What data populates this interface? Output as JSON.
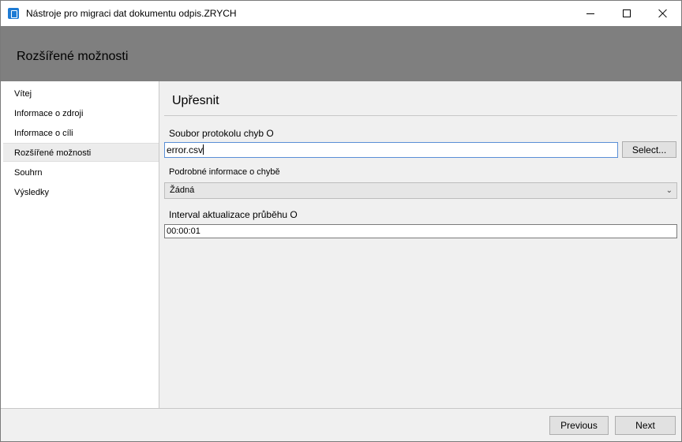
{
  "window": {
    "title": "Nástroje pro migraci dat dokumentu odpis.ZRYCH"
  },
  "header": {
    "title": "Rozšířené možnosti"
  },
  "sidebar": {
    "items": [
      {
        "label": "Vítej"
      },
      {
        "label": "Informace o zdroji"
      },
      {
        "label": "Informace o cíli"
      },
      {
        "label": "Rozšířené možnosti",
        "selected": true
      },
      {
        "label": "Souhrn"
      },
      {
        "label": "Výsledky"
      }
    ]
  },
  "main": {
    "section_title": "Upřesnit",
    "error_log": {
      "label": "Soubor protokolu chyb O",
      "value": "error.csv",
      "select_label": "Select..."
    },
    "error_details": {
      "label": "Podrobné informace o chybě",
      "selected": "Žádná"
    },
    "progress_interval": {
      "label": "Interval aktualizace průběhu O",
      "value": "00:00:01"
    }
  },
  "footer": {
    "previous_label": "Previous",
    "next_label": "Next"
  },
  "colors": {
    "header_band": "#7f7f7f",
    "window_bg": "#f0f0f0",
    "app_icon": "#1e7bd4"
  },
  "icons": {
    "app": "app-icon",
    "minimize": "minimize-icon",
    "maximize": "maximize-icon",
    "close": "close-icon",
    "dropdown": "chevron-down-icon"
  }
}
